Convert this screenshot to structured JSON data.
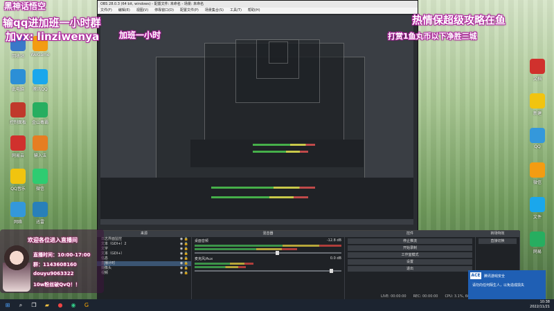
{
  "overlay": {
    "top_left_tag": "黑神话悟空",
    "qq_line": "输qq进加班一小时群",
    "wx_line": "加vx: linziwenya",
    "wx_suffix": "加班一小时",
    "right_banner": "热情保超级攻略在鱼",
    "right_banner2": "打赏1鱼丸币以下净胜三城"
  },
  "obs": {
    "title": "OBS 28.0.3 (64 bit, windows) - 配置文件: 未命名 - 场景: 未命名",
    "menus": [
      "文件(F)",
      "编辑(E)",
      "视图(V)",
      "停靠窗口(D)",
      "配置文件(P)",
      "场景集合(S)",
      "工具(T)",
      "帮助(H)"
    ]
  },
  "docks": {
    "scenes_title": "来源",
    "sources": [
      "日志界面监控",
      "文本（GDI+）2",
      "文字",
      "文本（GDI+）",
      "信息",
      "直播计时",
      "摄像头",
      "视频"
    ],
    "mixer_title": "混音器",
    "mixer": [
      {
        "name": "桌面音频",
        "db": "-12.8 dB"
      },
      {
        "name": "麦克风/Aux",
        "db": "0.0 dB"
      }
    ],
    "transitions_title": "转场特效",
    "transition_value": "直接切换",
    "controls_title": "控件",
    "controls": [
      "停止推流",
      "开始录制",
      "工作室模式",
      "设置",
      "退出"
    ]
  },
  "card": {
    "live_time": "直播时间：10:00-17:00",
    "group": "群：1143608160",
    "douyu": "douyu9063322",
    "fans": "10w粉丝破QvQ！！",
    "banner": "欢迎各位进入直播间"
  },
  "status": {
    "live": "LIVE: 00:00:00",
    "rec": "REC: 00:00:00",
    "cpu": "CPU: 3.1%, 60.00 fps"
  },
  "notification": {
    "title": "腾讯游戏安全",
    "body": "请勿向任何陌生人，以免造成损失"
  },
  "clock": {
    "time": "10:38",
    "date": "2022/11/21"
  },
  "desktop_icons_left": [
    "回收站",
    "此电脑",
    "控制面板",
    "网易云",
    "QQ音乐",
    "网络",
    "WeGame",
    "腾讯QQ",
    "金山毒霸",
    "输入法",
    "微信",
    "迅雷"
  ],
  "desktop_icons_right": [
    "文档",
    "新建",
    "QQ",
    "微信",
    "文件",
    "网易"
  ]
}
